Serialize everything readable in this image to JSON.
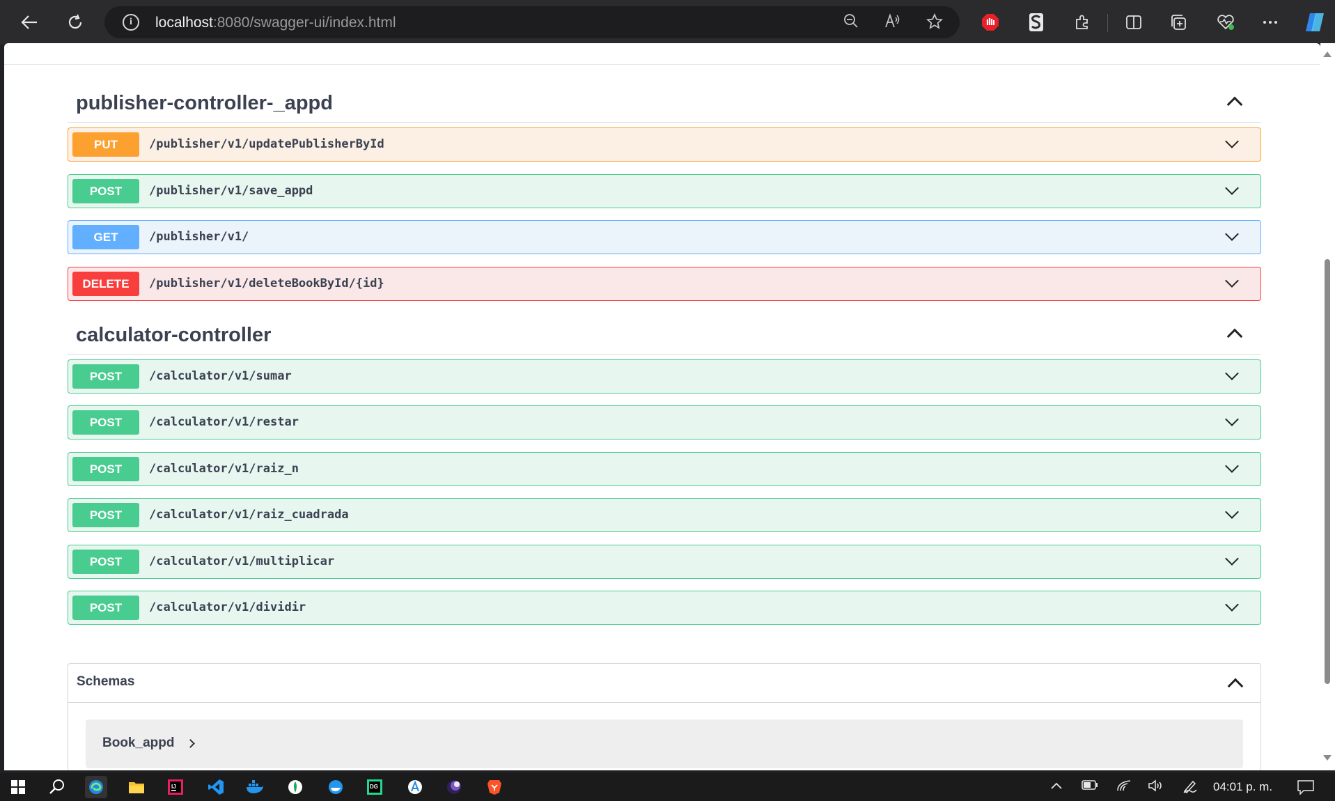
{
  "browser": {
    "url_host": "localhost",
    "url_rest": ":8080/swagger-ui/index.html",
    "icons": [
      "back-icon",
      "refresh-icon",
      "info-icon",
      "zoom-out-icon",
      "read-aloud-icon",
      "favorite-star-icon",
      "adblock-extension-icon",
      "scribbr-extension-icon",
      "extensions-icon",
      "split-screen-icon",
      "collections-icon",
      "browser-essentials-icon",
      "more-options-icon",
      "copilot-icon"
    ]
  },
  "sections": [
    {
      "title": "publisher-controller-_appd",
      "operations": [
        {
          "method": "PUT",
          "path": "/publisher/v1/updatePublisherById"
        },
        {
          "method": "POST",
          "path": "/publisher/v1/save_appd"
        },
        {
          "method": "GET",
          "path": "/publisher/v1/"
        },
        {
          "method": "DELETE",
          "path": "/publisher/v1/deleteBookById/{id}"
        }
      ]
    },
    {
      "title": "calculator-controller",
      "operations": [
        {
          "method": "POST",
          "path": "/calculator/v1/sumar"
        },
        {
          "method": "POST",
          "path": "/calculator/v1/restar"
        },
        {
          "method": "POST",
          "path": "/calculator/v1/raiz_n"
        },
        {
          "method": "POST",
          "path": "/calculator/v1/raiz_cuadrada"
        },
        {
          "method": "POST",
          "path": "/calculator/v1/multiplicar"
        },
        {
          "method": "POST",
          "path": "/calculator/v1/dividir"
        }
      ]
    }
  ],
  "schemas": {
    "title": "Schemas",
    "models": [
      "Book_appd"
    ]
  },
  "method_colors": {
    "PUT": "#fca130",
    "POST": "#49cc90",
    "GET": "#61affe",
    "DELETE": "#f93e3e"
  },
  "taskbar": {
    "apps": [
      "windows-start-icon",
      "search-icon",
      "edge-icon",
      "file-explorer-icon",
      "intellij-icon",
      "vscode-icon",
      "docker-desktop-icon",
      "mongodb-compass-icon",
      "docker-icon",
      "datagrip-icon",
      "app-icon",
      "eclipse-icon",
      "brave-icon"
    ],
    "clock": "04:01 p. m."
  }
}
